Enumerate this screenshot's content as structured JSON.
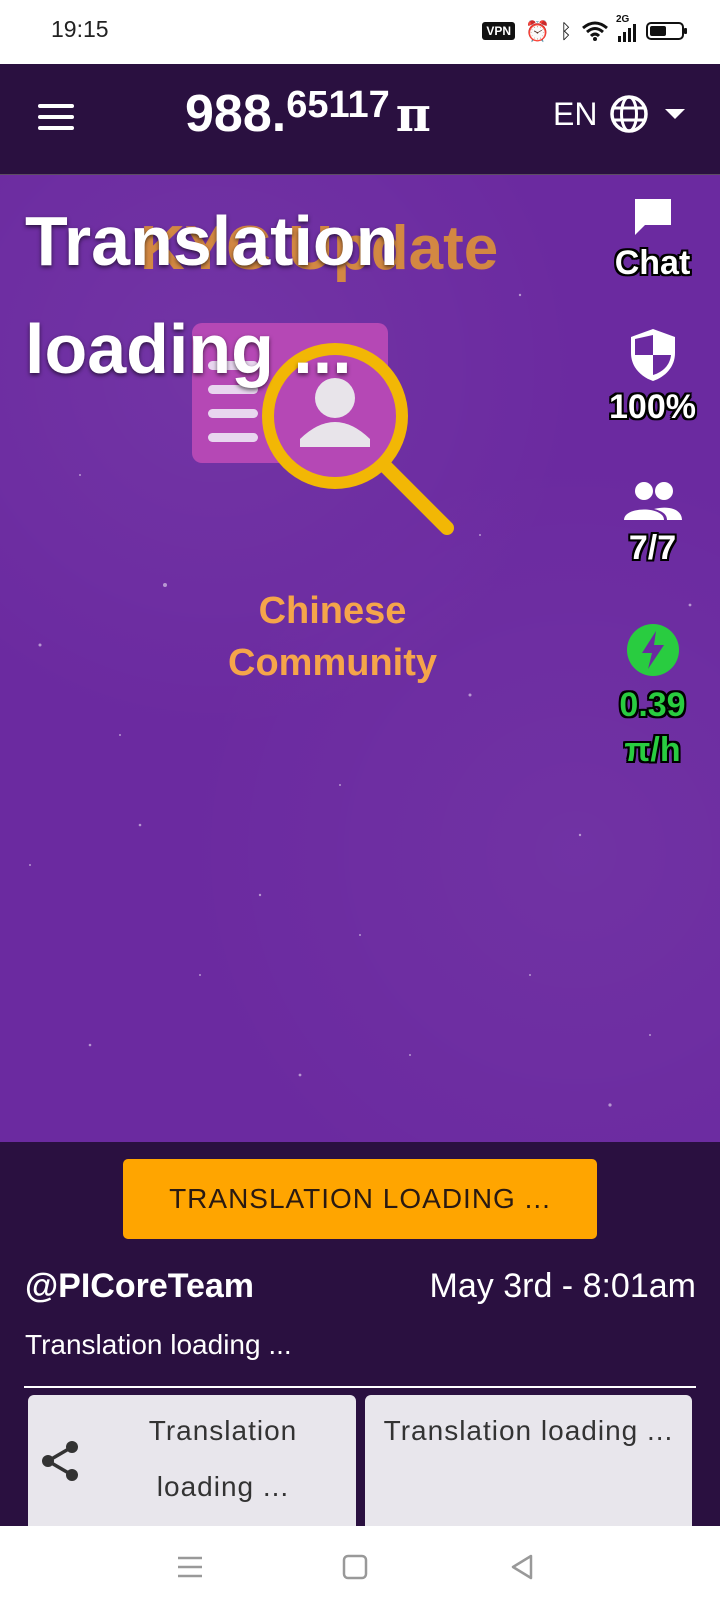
{
  "status_bar": {
    "time": "19:15",
    "vpn": "VPN",
    "network": "2G"
  },
  "header": {
    "balance_integer": "988.",
    "balance_decimal": "65117",
    "currency_symbol": "π",
    "language": "EN"
  },
  "hero": {
    "title": "Translation loading ...",
    "graphic_heading": "KYC Update",
    "graphic_caption": "Chinese Community"
  },
  "side_stats": {
    "chat_label": "Chat",
    "security_label": "100%",
    "team_label": "7/7",
    "mining_rate": "0.39",
    "mining_unit": "π/h"
  },
  "post": {
    "button_label": "TRANSLATION LOADING ...",
    "author": "@PICoreTeam",
    "date": "May 3rd - 8:01am",
    "text": "Translation loading ...",
    "share_label": "Translation loading ...",
    "second_label": "Translation loading ..."
  },
  "colors": {
    "header_bg": "#2a1040",
    "hero_bg": "#6b2aa0",
    "accent_orange": "#ffa500",
    "mining_green": "#29cc40"
  },
  "icons": [
    "menu-icon",
    "globe-icon",
    "chevron-down-icon",
    "chat-icon",
    "shield-icon",
    "users-icon",
    "bolt-icon",
    "share-icon"
  ]
}
